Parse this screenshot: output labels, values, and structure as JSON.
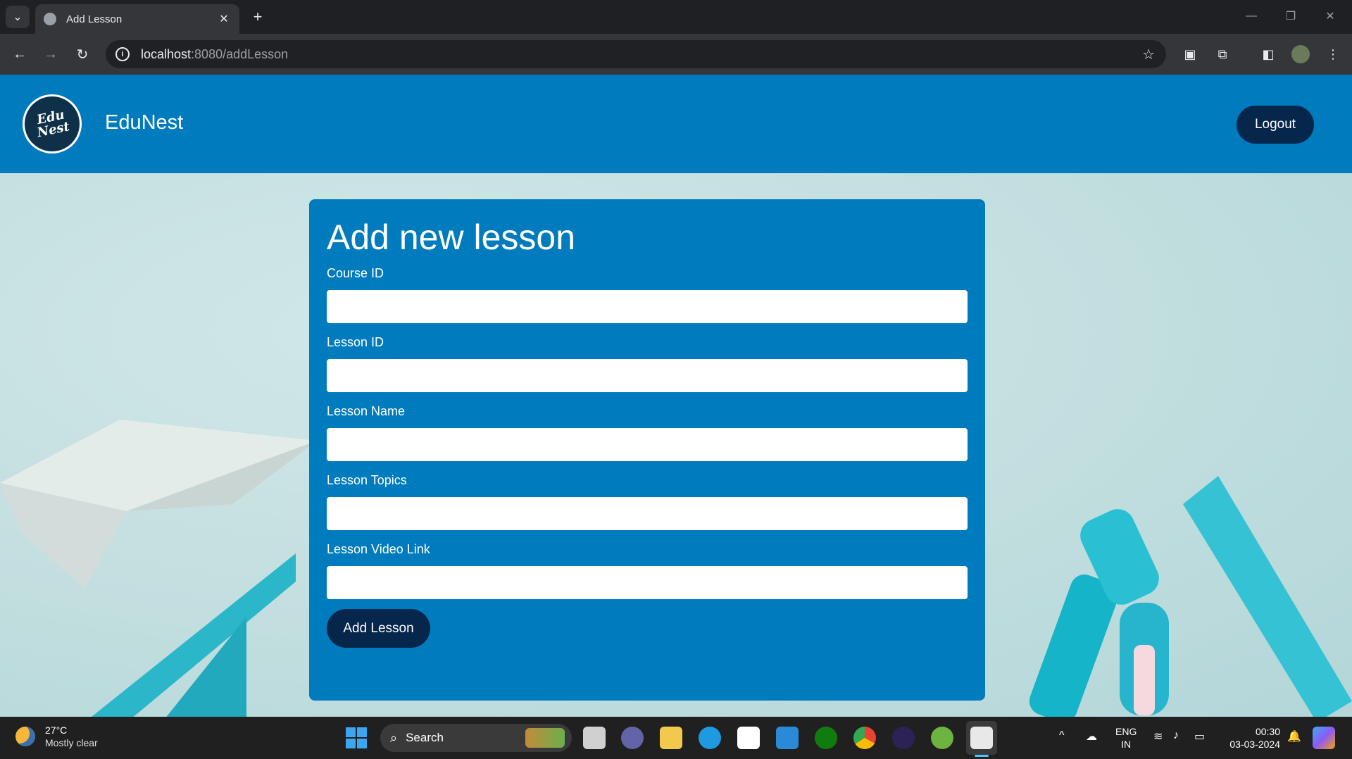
{
  "browser": {
    "tab_title": "Add Lesson",
    "url_host": "localhost",
    "url_path": ":8080/addLesson"
  },
  "site": {
    "brand": "EduNest",
    "logo_text": "Edu Nest",
    "logout_label": "Logout"
  },
  "form": {
    "heading": "Add new lesson",
    "fields": [
      {
        "label": "Course ID",
        "value": ""
      },
      {
        "label": "Lesson ID",
        "value": ""
      },
      {
        "label": "Lesson Name",
        "value": ""
      },
      {
        "label": "Lesson Topics",
        "value": ""
      },
      {
        "label": "Lesson Video Link",
        "value": ""
      }
    ],
    "submit_label": "Add Lesson"
  },
  "taskbar": {
    "weather_temp": "27°C",
    "weather_desc": "Mostly clear",
    "search_label": "Search",
    "lang_primary": "ENG",
    "lang_region": "IN",
    "time": "00:30",
    "date": "03-03-2024"
  },
  "colors": {
    "header": "#007bbd",
    "card": "#007bbd",
    "button": "#06264b"
  }
}
